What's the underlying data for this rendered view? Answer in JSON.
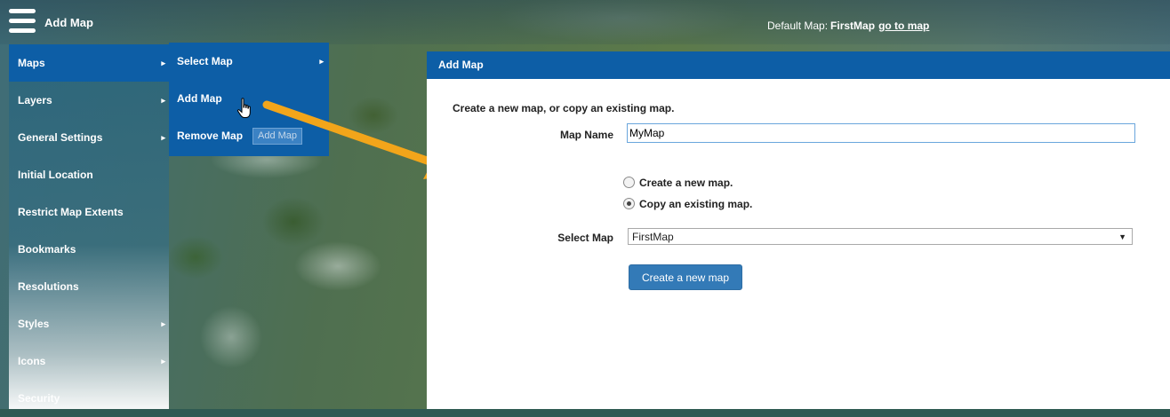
{
  "header": {
    "title": "Add Map",
    "default_map_label": "Default Map:",
    "default_map_value": "FirstMap",
    "go_to_map": "go to map"
  },
  "sidebar": {
    "items": [
      {
        "label": "Maps",
        "has_submenu": true
      },
      {
        "label": "Layers",
        "has_submenu": true
      },
      {
        "label": "General Settings",
        "has_submenu": true
      },
      {
        "label": "Initial Location",
        "has_submenu": false
      },
      {
        "label": "Restrict Map Extents",
        "has_submenu": false
      },
      {
        "label": "Bookmarks",
        "has_submenu": false
      },
      {
        "label": "Resolutions",
        "has_submenu": false
      },
      {
        "label": "Styles",
        "has_submenu": true
      },
      {
        "label": "Icons",
        "has_submenu": true
      },
      {
        "label": "Security",
        "has_submenu": false
      }
    ]
  },
  "submenu": {
    "items": [
      {
        "label": "Select Map",
        "has_submenu": true
      },
      {
        "label": "Add Map",
        "has_submenu": false
      },
      {
        "label": "Remove Map",
        "has_submenu": false
      }
    ],
    "tooltip": "Add Map"
  },
  "panel": {
    "title": "Add Map",
    "description": "Create a new map, or copy an existing map.",
    "map_name_label": "Map Name",
    "map_name_value": "MyMap",
    "radio_new_label": "Create a new map.",
    "radio_copy_label": "Copy an existing map.",
    "selected_radio": "copy",
    "select_map_label": "Select Map",
    "select_map_value": "FirstMap",
    "create_button": "Create a new map"
  },
  "colors": {
    "accent": "#0d5ea6",
    "button": "#337ab7",
    "annotation_arrow": "#f2a51a"
  },
  "icons": [
    "hamburger-icon",
    "chevron-right-icon",
    "hand-cursor-icon",
    "dropdown-caret-icon"
  ]
}
